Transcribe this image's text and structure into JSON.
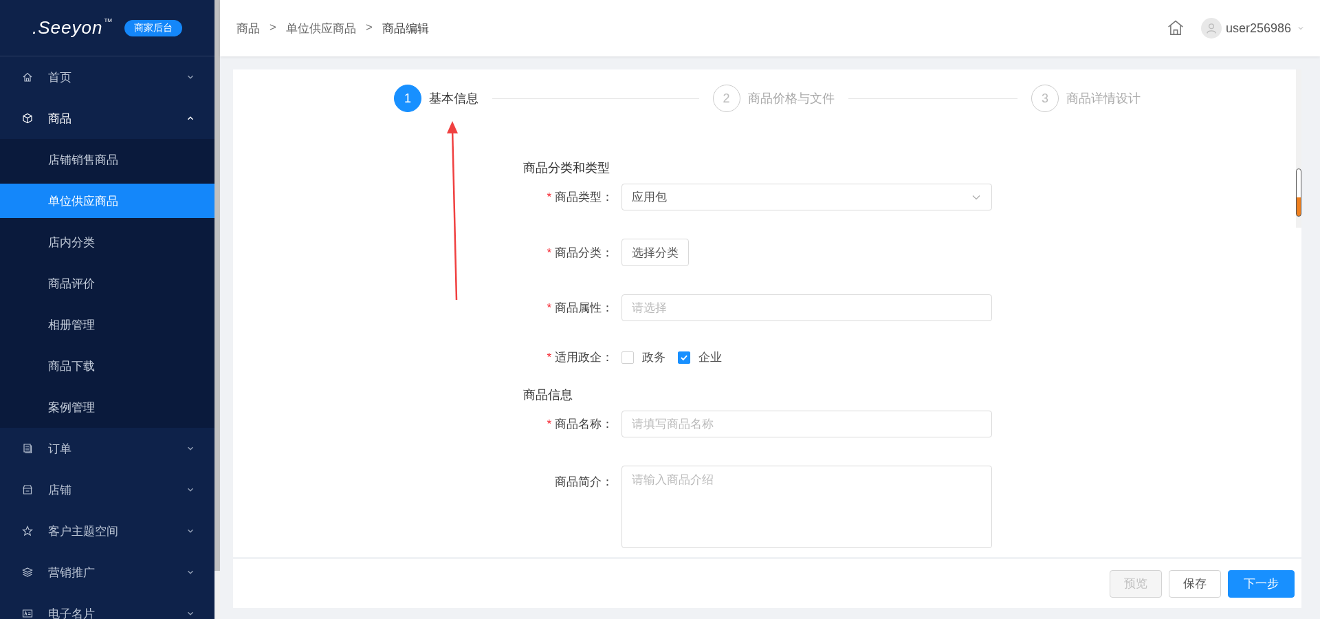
{
  "brand": {
    "logo": ".Seeyon",
    "trademark": "TM",
    "badge": "商家后台"
  },
  "sidebar": {
    "items": [
      {
        "label": "首页",
        "expanded": false
      },
      {
        "label": "商品",
        "expanded": true,
        "children": [
          {
            "label": "店铺销售商品",
            "selected": false
          },
          {
            "label": "单位供应商品",
            "selected": true
          },
          {
            "label": "店内分类",
            "selected": false
          },
          {
            "label": "商品评价",
            "selected": false
          },
          {
            "label": "相册管理",
            "selected": false
          },
          {
            "label": "商品下载",
            "selected": false
          },
          {
            "label": "案例管理",
            "selected": false
          }
        ]
      },
      {
        "label": "订单",
        "expanded": false
      },
      {
        "label": "店铺",
        "expanded": false
      },
      {
        "label": "客户主题空间",
        "expanded": false
      },
      {
        "label": "营销推广",
        "expanded": false
      },
      {
        "label": "电子名片",
        "expanded": false
      }
    ]
  },
  "header": {
    "breadcrumb": [
      "商品",
      "单位供应商品",
      "商品编辑"
    ],
    "separator": ">",
    "user": "user256986"
  },
  "steps": [
    {
      "number": "1",
      "label": "基本信息",
      "selected": true
    },
    {
      "number": "2",
      "label": "商品价格与文件",
      "selected": false
    },
    {
      "number": "3",
      "label": "商品详情设计",
      "selected": false
    }
  ],
  "required_mark": "*",
  "sections": [
    {
      "title": "商品分类和类型",
      "fields": [
        {
          "kind": "select",
          "label": "商品类型：",
          "required": true,
          "value": "应用包"
        },
        {
          "kind": "button",
          "label": "商品分类：",
          "required": true,
          "value": "选择分类"
        },
        {
          "kind": "input",
          "label": "商品属性：",
          "required": true,
          "placeholder": "请选择"
        },
        {
          "kind": "checkboxes",
          "label": "适用政企：",
          "required": true,
          "options": [
            {
              "label": "政务",
              "checked": false
            },
            {
              "label": "企业",
              "checked": true
            }
          ]
        }
      ]
    },
    {
      "title": "商品信息",
      "fields": [
        {
          "kind": "input",
          "label": "商品名称：",
          "required": true,
          "placeholder": "请填写商品名称"
        },
        {
          "kind": "textarea",
          "label": "商品简介：",
          "required": false,
          "placeholder": "请输入商品介绍"
        }
      ]
    }
  ],
  "footer": {
    "buttons": [
      {
        "label": "预览",
        "kind": "default",
        "disabled": true
      },
      {
        "label": "保存",
        "kind": "default",
        "disabled": false
      },
      {
        "label": "下一步",
        "kind": "primary",
        "disabled": false
      }
    ]
  }
}
